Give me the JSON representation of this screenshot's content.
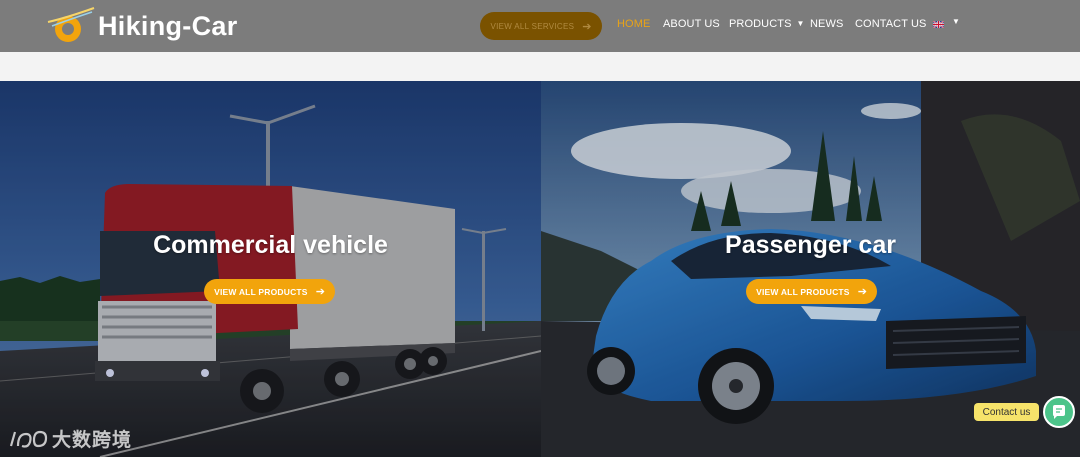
{
  "header": {
    "logo_text": "Hiking-Car",
    "cta_label": "VIEW ALL SERVICES",
    "nav": [
      {
        "label": "HOME",
        "active": true
      },
      {
        "label": "ABOUT US"
      },
      {
        "label": "PRODUCTS",
        "dropdown": true
      },
      {
        "label": "NEWS"
      },
      {
        "label": "CONTACT US"
      }
    ],
    "language_icon": "uk-flag-icon"
  },
  "panels": {
    "left": {
      "title": "Commercial vehicle",
      "cta_label": "VIEW ALL PRODUCTS"
    },
    "right": {
      "title": "Passenger car",
      "cta_label": "VIEW ALL PRODUCTS"
    }
  },
  "contact": {
    "label": "Contact us",
    "icon": "chat-icon"
  },
  "watermark": {
    "text": "大数跨境"
  },
  "colors": {
    "header_bg": "#7c7c7c",
    "accent": "#f2a40c",
    "active_nav": "#e8a317",
    "contact_pill": "#f6e36a",
    "contact_bubble": "#4cc48a"
  }
}
